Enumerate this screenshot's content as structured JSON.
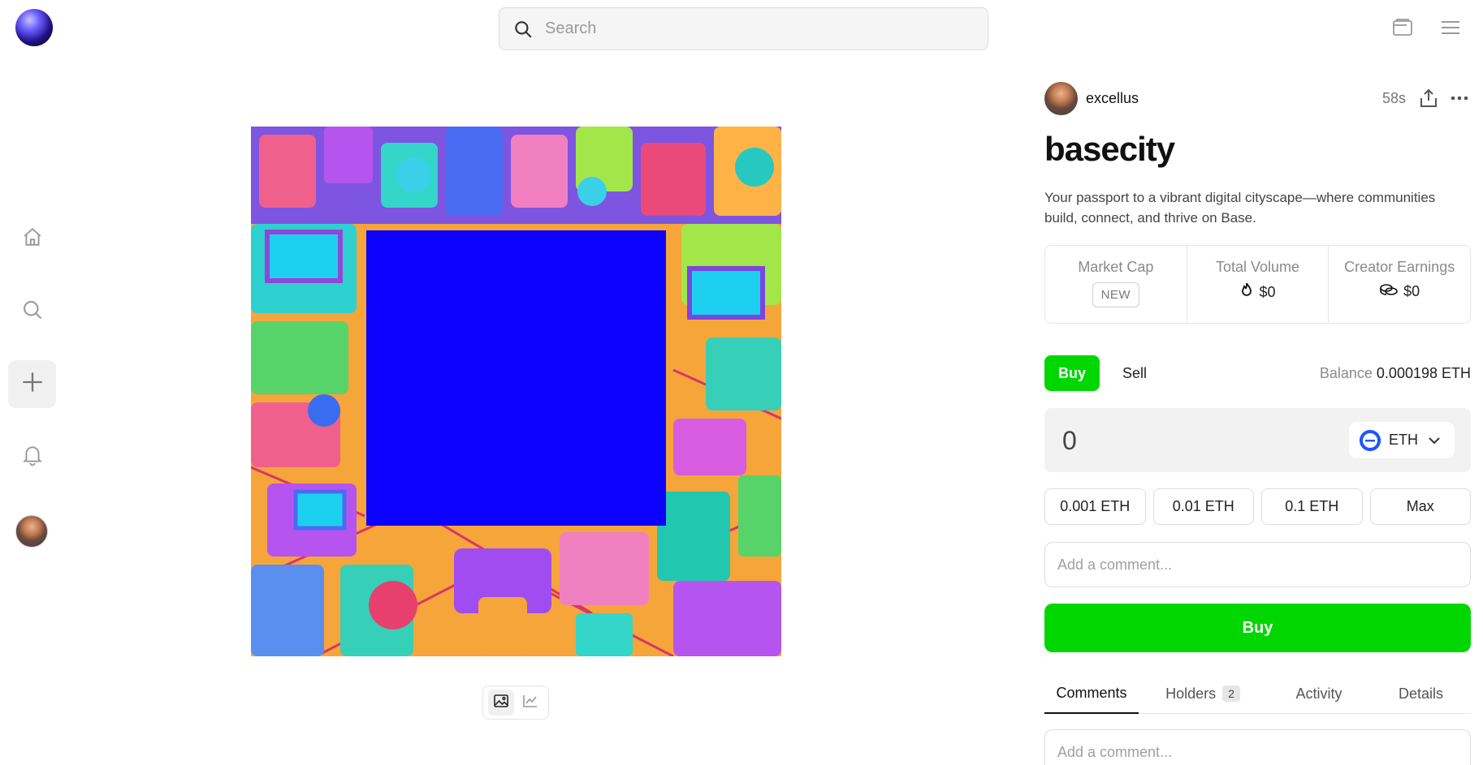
{
  "app": {
    "logo": "orb-logo"
  },
  "search": {
    "placeholder": "Search"
  },
  "topbar": {
    "wallet_icon": "wallet-icon",
    "menu_icon": "hamburger-menu-icon"
  },
  "sidebar": {
    "items": [
      {
        "icon": "home-icon"
      },
      {
        "icon": "search-icon"
      },
      {
        "icon": "plus-icon",
        "active": true
      },
      {
        "icon": "bell-icon"
      },
      {
        "icon": "avatar"
      }
    ]
  },
  "artwork": {
    "description": "colorful isometric city illustration with blue square overlay"
  },
  "view_toggle": {
    "options": [
      "image-icon",
      "chart-icon"
    ],
    "selected": "image-icon"
  },
  "coin": {
    "creator": "excellus",
    "time_ago": "58s",
    "name": "basecity",
    "description": "Your passport to a vibrant digital cityscape—where communities build, connect, and thrive on Base."
  },
  "stats": {
    "market_cap_label": "Market Cap",
    "market_cap_value": "NEW",
    "total_volume_label": "Total Volume",
    "total_volume_value": "$0",
    "creator_earnings_label": "Creator Earnings",
    "creator_earnings_value": "$0"
  },
  "trade": {
    "buy_tab": "Buy",
    "sell_tab": "Sell",
    "balance_label": "Balance",
    "balance_value": "0.000198 ETH",
    "amount": "0",
    "currency": "ETH",
    "presets": [
      "0.001 ETH",
      "0.01 ETH",
      "0.1 ETH",
      "Max"
    ],
    "comment_placeholder": "Add a comment...",
    "buy_button": "Buy"
  },
  "tabs": {
    "comments": "Comments",
    "holders": "Holders",
    "holders_count": "2",
    "activity": "Activity",
    "details": "Details"
  },
  "comments_section": {
    "placeholder": "Add a comment..."
  },
  "colors": {
    "accent_green": "#00d700",
    "eth_blue": "#1d56ff",
    "overlay_blue": "#0c00ff"
  }
}
